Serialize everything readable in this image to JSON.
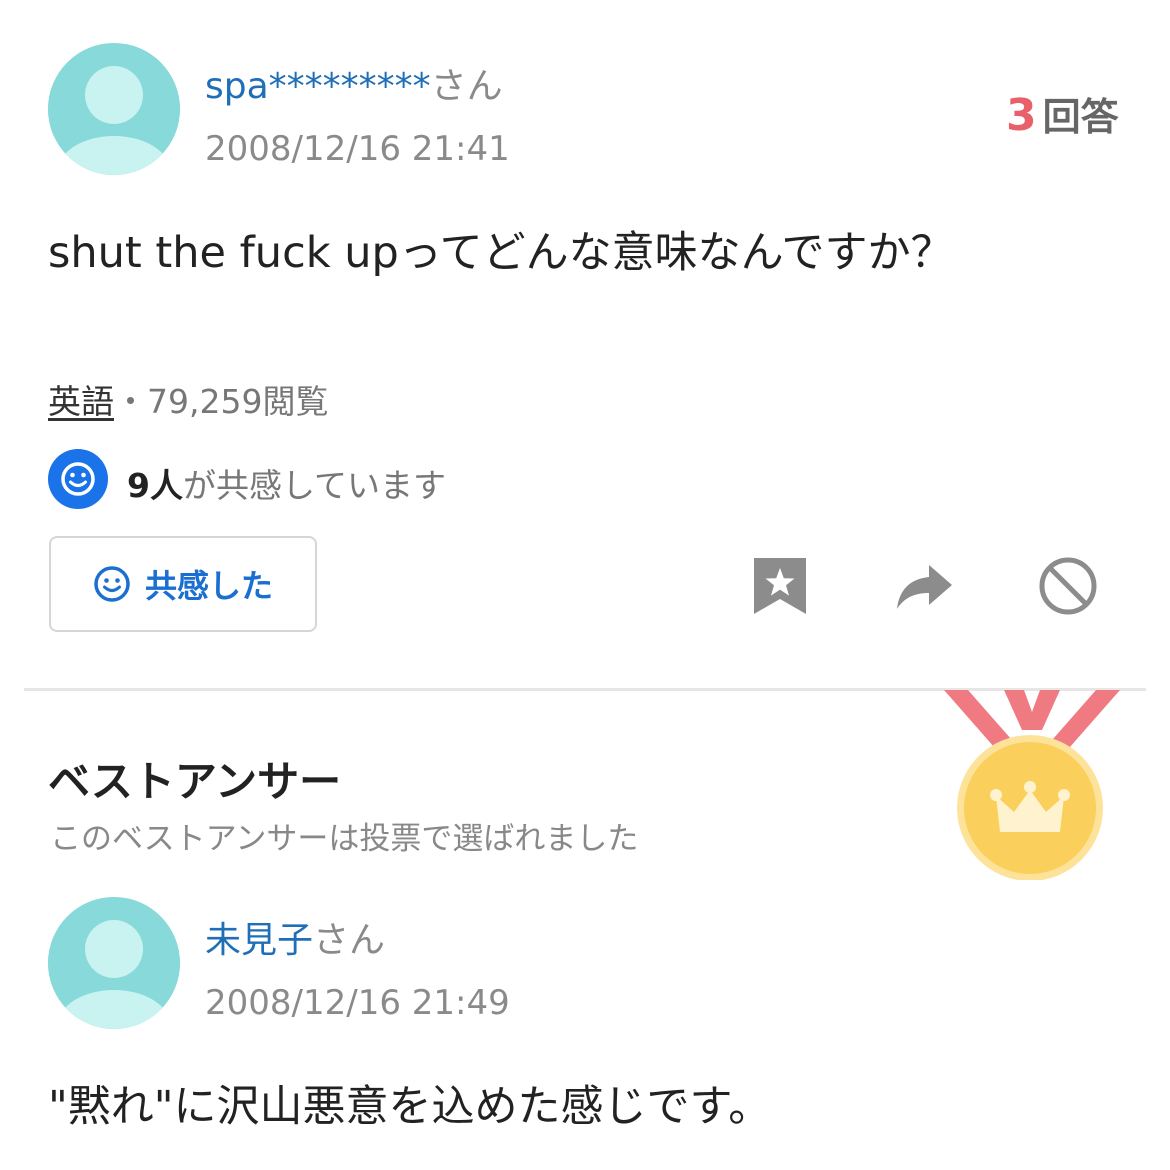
{
  "question": {
    "user_name": "spa*********",
    "user_suffix": "さん",
    "date": "2008/12/16 21:41",
    "answer_count": "3",
    "answer_label": "回答",
    "text": "shut the fuck upってどんな意味なんですか？",
    "category": "英語",
    "views": "・79,259閲覧",
    "empathy_count": "9人",
    "empathy_suffix": "が共感しています",
    "empathy_button_label": "共感した"
  },
  "actions": {
    "icons": [
      "bookmark-star-icon",
      "share-arrow-icon",
      "block-icon"
    ]
  },
  "best_answer": {
    "title": "ベストアンサー",
    "subtitle": "このベストアンサーは投票で選ばれました",
    "user_name": "未見子",
    "user_suffix": "さん",
    "date": "2008/12/16 21:49",
    "text": "\"黙れ\"に沢山悪意を込めた感じです。"
  },
  "colors": {
    "link_blue": "#1f6fb8",
    "accent_red": "#e8606a",
    "empathy_blue": "#1a73e8",
    "avatar_teal": "#88d9d9",
    "medal_gold": "#fbcf5b",
    "ribbon_red": "#f07a82"
  }
}
